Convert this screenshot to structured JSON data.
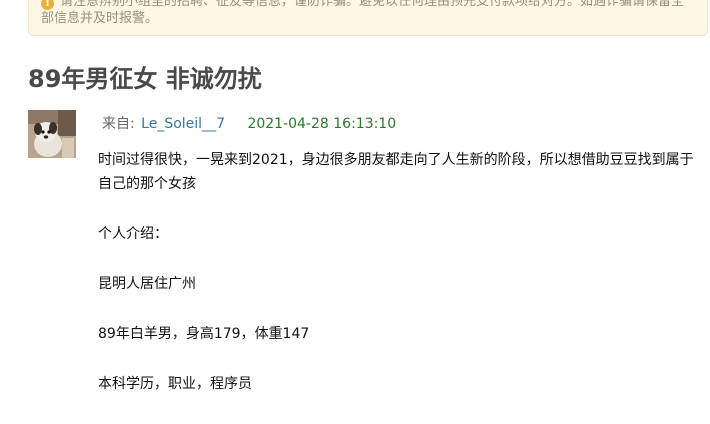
{
  "notice": {
    "line1": "请注意辨别小组里的招聘、征友等信息，谨防诈骗。避免以任何理由预先支付款项给对方。如遇诈骗请保留全",
    "line2": "部信息并及时报警。"
  },
  "topic": {
    "title": "89年男征女 非诚勿扰"
  },
  "meta": {
    "from_label": "来自:",
    "author": "Le_Soleil__7",
    "timestamp": "2021-04-28 16:13:10"
  },
  "content": {
    "paragraphs": [
      "时间过得很快，一晃来到2021，身边很多朋友都走向了人生新的阶段，所以想借助豆豆找到属于自己的那个女孩",
      "个人介绍：",
      "昆明人居住广州",
      "89年白羊男，身高179，体重147",
      "本科学历，职业，程序员"
    ]
  },
  "colors": {
    "notice_bg": "#fff7e6",
    "title": "#494949",
    "author_link": "#3377aa",
    "timestamp": "#2a7a2a"
  }
}
